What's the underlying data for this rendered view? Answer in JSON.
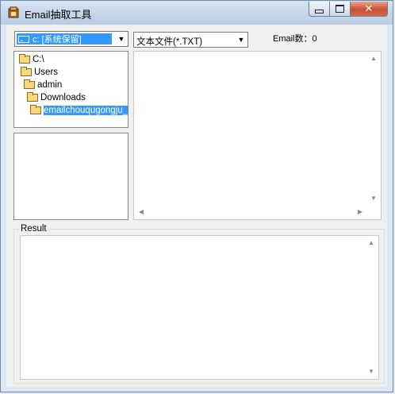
{
  "window": {
    "title": "Email抽取工具",
    "buttons": {
      "minimize": "▭",
      "maximize": "▢",
      "close": "✕"
    }
  },
  "toolbar": {
    "drive_selected": "c: [系统保留]",
    "file_type_selected": "文本文件(*.TXT)",
    "email_count_label": "Email数：0"
  },
  "folder_tree": {
    "items": [
      {
        "label": "C:\\",
        "icon": "open-folder-icon"
      },
      {
        "label": "Users",
        "icon": "open-folder-icon"
      },
      {
        "label": "admin",
        "icon": "open-folder-icon"
      },
      {
        "label": "Downloads",
        "icon": "open-folder-icon"
      },
      {
        "label": "emailchouqugongju_it",
        "icon": "open-folder-icon",
        "selected": true
      }
    ]
  },
  "result": {
    "label": "Result"
  },
  "colors": {
    "selection": "#3399ff",
    "close_button": "#c8502f"
  }
}
